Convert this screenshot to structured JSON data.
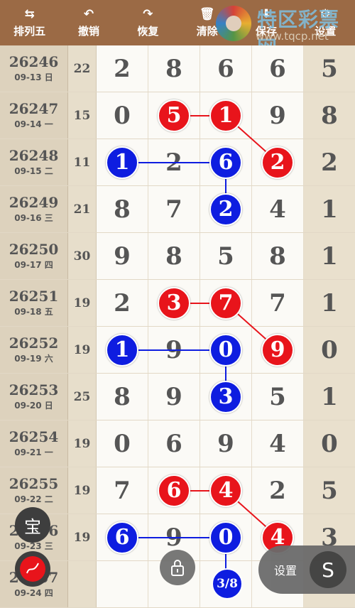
{
  "toolbar": [
    {
      "label": "排列五",
      "icon": "⇆",
      "icon_name": "swap-icon"
    },
    {
      "label": "撤销",
      "icon": "↶",
      "icon_name": "undo-icon"
    },
    {
      "label": "恢复",
      "icon": "↷",
      "icon_name": "redo-icon"
    },
    {
      "label": "清除",
      "icon": "🗑",
      "icon_name": "trash-icon"
    },
    {
      "label": "保存",
      "icon": "⬇",
      "icon_name": "download-icon"
    },
    {
      "label": "设置",
      "icon": "⚙",
      "icon_name": "gear-icon"
    }
  ],
  "watermark": {
    "title": "特区彩票网",
    "url": "www.tqcp.net"
  },
  "rows": [
    {
      "issue": "26246",
      "date": "09-13 日",
      "sum": "22",
      "digits": [
        "2",
        "8",
        "6",
        "6",
        "5"
      ],
      "marks": [
        null,
        null,
        null,
        null,
        null
      ]
    },
    {
      "issue": "26247",
      "date": "09-14 一",
      "sum": "15",
      "digits": [
        "0",
        "5",
        "1",
        "9",
        "8"
      ],
      "marks": [
        null,
        "red",
        "red",
        null,
        null
      ]
    },
    {
      "issue": "26248",
      "date": "09-15 二",
      "sum": "11",
      "digits": [
        "1",
        "2",
        "6",
        "2",
        "2"
      ],
      "marks": [
        "blue",
        null,
        "blue",
        "red",
        null
      ]
    },
    {
      "issue": "26249",
      "date": "09-16 三",
      "sum": "21",
      "digits": [
        "8",
        "7",
        "2",
        "4",
        "1"
      ],
      "marks": [
        null,
        null,
        "blue",
        null,
        null
      ]
    },
    {
      "issue": "26250",
      "date": "09-17 四",
      "sum": "30",
      "digits": [
        "9",
        "8",
        "5",
        "8",
        "1"
      ],
      "marks": [
        null,
        null,
        null,
        null,
        null
      ]
    },
    {
      "issue": "26251",
      "date": "09-18 五",
      "sum": "19",
      "digits": [
        "2",
        "3",
        "7",
        "7",
        "1"
      ],
      "marks": [
        null,
        "red",
        "red",
        null,
        null
      ]
    },
    {
      "issue": "26252",
      "date": "09-19 六",
      "sum": "19",
      "digits": [
        "1",
        "9",
        "0",
        "9",
        "0"
      ],
      "marks": [
        "blue",
        null,
        "blue",
        "red",
        null
      ]
    },
    {
      "issue": "26253",
      "date": "09-20 日",
      "sum": "25",
      "digits": [
        "8",
        "9",
        "3",
        "5",
        "1"
      ],
      "marks": [
        null,
        null,
        "blue",
        null,
        null
      ]
    },
    {
      "issue": "26254",
      "date": "09-21 一",
      "sum": "19",
      "digits": [
        "0",
        "6",
        "9",
        "4",
        "0"
      ],
      "marks": [
        null,
        null,
        null,
        null,
        null
      ]
    },
    {
      "issue": "26255",
      "date": "09-22 二",
      "sum": "19",
      "digits": [
        "7",
        "6",
        "4",
        "2",
        "5"
      ],
      "marks": [
        null,
        "red",
        "red",
        null,
        null
      ]
    },
    {
      "issue": "26256",
      "date": "09-23 三",
      "sum": "19",
      "digits": [
        "6",
        "9",
        "0",
        "4",
        "3"
      ],
      "marks": [
        "blue",
        null,
        "blue",
        "red",
        null
      ]
    },
    {
      "issue": "26257",
      "date": "09-24 四",
      "sum": "",
      "digits": [
        "",
        "",
        "",
        "",
        ""
      ],
      "marks": [
        null,
        null,
        null,
        null,
        null
      ]
    }
  ],
  "links": [
    {
      "color": "#e8141b",
      "from": [
        1,
        1
      ],
      "to": [
        1,
        2
      ]
    },
    {
      "color": "#e8141b",
      "from": [
        1,
        2
      ],
      "to": [
        2,
        3
      ]
    },
    {
      "color": "#0e1de0",
      "from": [
        2,
        0
      ],
      "to": [
        2,
        2
      ]
    },
    {
      "color": "#0e1de0",
      "from": [
        2,
        2
      ],
      "to": [
        3,
        2
      ]
    },
    {
      "color": "#e8141b",
      "from": [
        5,
        1
      ],
      "to": [
        5,
        2
      ]
    },
    {
      "color": "#e8141b",
      "from": [
        5,
        2
      ],
      "to": [
        6,
        3
      ]
    },
    {
      "color": "#0e1de0",
      "from": [
        6,
        0
      ],
      "to": [
        6,
        2
      ]
    },
    {
      "color": "#0e1de0",
      "from": [
        6,
        2
      ],
      "to": [
        7,
        2
      ]
    },
    {
      "color": "#e8141b",
      "from": [
        9,
        1
      ],
      "to": [
        9,
        2
      ]
    },
    {
      "color": "#e8141b",
      "from": [
        9,
        2
      ],
      "to": [
        10,
        3
      ]
    },
    {
      "color": "#0e1de0",
      "from": [
        10,
        0
      ],
      "to": [
        10,
        2
      ]
    },
    {
      "color": "#0e1de0",
      "from": [
        10,
        2
      ],
      "to": [
        11,
        2
      ]
    }
  ],
  "overlay": {
    "bao_label": "宝",
    "page_indicator": "3/8",
    "settings_label": "设置",
    "s_label": "S"
  },
  "colors": {
    "toolbar": "#9b6a45",
    "red_ball": "#e8141b",
    "blue_ball": "#0e1de0"
  }
}
